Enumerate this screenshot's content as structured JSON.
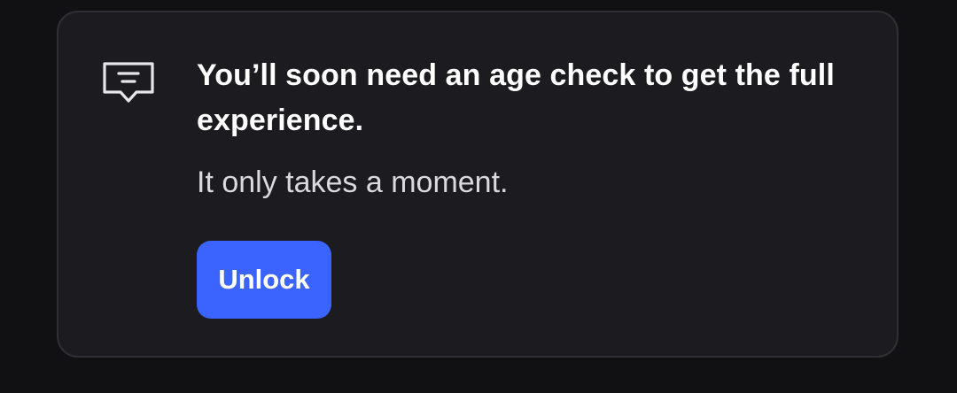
{
  "notice": {
    "icon": "message-alert-icon",
    "title": "You’ll soon need an age check to get the full experience.",
    "subtitle": "It only takes a moment.",
    "action_label": "Unlock"
  },
  "colors": {
    "page_background": "#111114",
    "card_background": "#1c1c20",
    "card_border": "#2f2f35",
    "title_text": "#ffffff",
    "subtitle_text": "#d9d9de",
    "button_background": "#3b64ff",
    "button_text": "#ffffff",
    "icon_stroke": "#e6e6ea"
  }
}
